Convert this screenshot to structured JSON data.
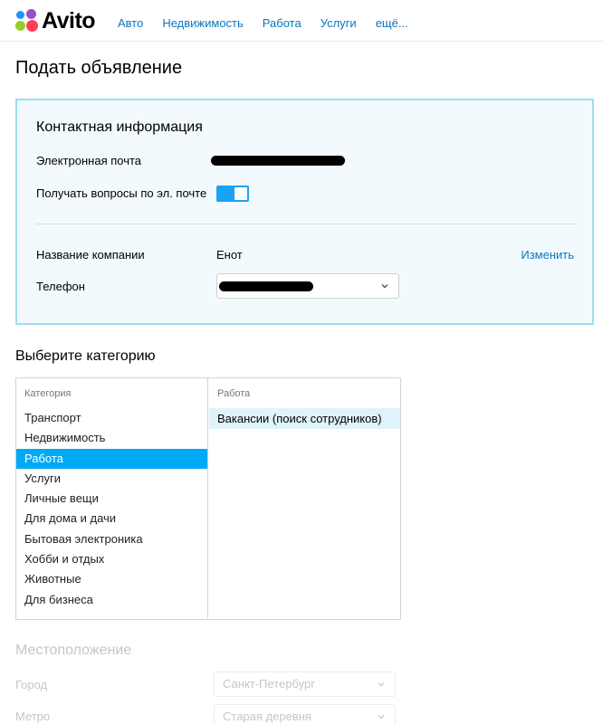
{
  "header": {
    "logo_text": "Avito",
    "nav": [
      "Авто",
      "Недвижимость",
      "Работа",
      "Услуги",
      "ещё..."
    ]
  },
  "page_title": "Подать объявление",
  "contact": {
    "title": "Контактная информация",
    "email_label": "Электронная почта",
    "email_value": "",
    "questions_label": "Получать вопросы по эл. почте",
    "questions_enabled": true,
    "company_label": "Название компании",
    "company_value": "Енот",
    "change_link": "Изменить",
    "phone_label": "Телефон",
    "phone_value": ""
  },
  "category": {
    "title": "Выберите категорию",
    "left_header": "Категория",
    "items": [
      "Транспорт",
      "Недвижимость",
      "Работа",
      "Услуги",
      "Личные вещи",
      "Для дома и дачи",
      "Бытовая электроника",
      "Хобби и отдых",
      "Животные",
      "Для бизнеса"
    ],
    "selected": "Работа",
    "right_header": "Работа",
    "subitems": [
      "Вакансии (поиск сотрудников)"
    ]
  },
  "location": {
    "title": "Местоположение",
    "city_label": "Город",
    "city_value": "Санкт-Петербург",
    "metro_label": "Метро",
    "metro_value": "Старая деревня"
  },
  "colors": {
    "accent": "#00a9f6",
    "link": "#0a77c2",
    "panel_bg": "#f3fafd",
    "panel_border": "#9fdaf3"
  }
}
